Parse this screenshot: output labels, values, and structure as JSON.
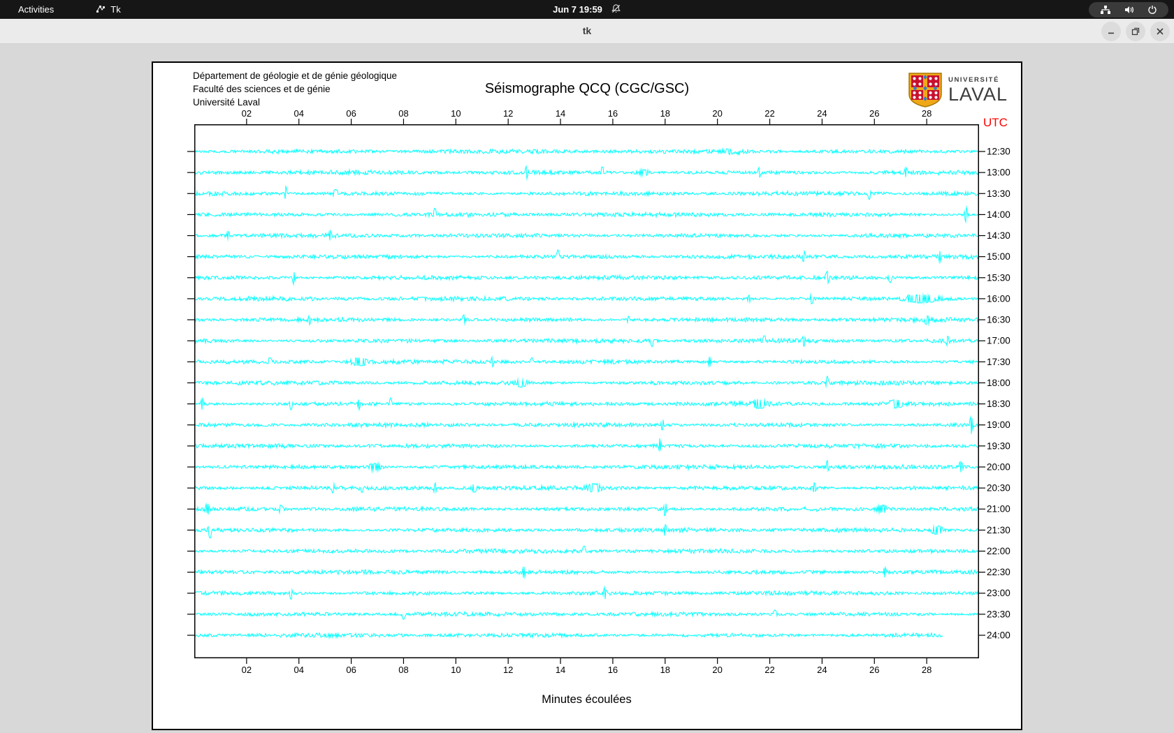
{
  "topbar": {
    "activities_label": "Activities",
    "app_name": "Tk",
    "clock": "Jun 7 19:59"
  },
  "window": {
    "title": "tk"
  },
  "canvas_header": {
    "line1": "Département de géologie et de génie géologique",
    "line2": "Faculté des sciences et de génie",
    "line3": "Université Laval"
  },
  "logo": {
    "line1": "UNIVERSITÉ",
    "line2": "LAVAL"
  },
  "colors": {
    "trace": "#00ffff",
    "utc_label": "#ff0000",
    "axis": "#000000"
  },
  "chart_data": {
    "type": "line",
    "title": "Séismographe QCQ (CGC/GSC)",
    "xlabel": "Minutes écoulées",
    "y_axis_label": "UTC",
    "x_range_minutes": [
      0,
      30
    ],
    "x_tick_labels": [
      "02",
      "04",
      "06",
      "08",
      "10",
      "12",
      "14",
      "16",
      "18",
      "20",
      "22",
      "24",
      "26",
      "28"
    ],
    "rows": [
      {
        "utc": "12:30",
        "end": 30,
        "spikes": [
          [
            20.5,
            2.5,
            12
          ]
        ]
      },
      {
        "utc": "13:00",
        "end": 30,
        "spikes": [
          [
            12.7,
            7,
            1.2
          ],
          [
            15.6,
            8,
            1.2
          ],
          [
            17.2,
            3,
            10
          ],
          [
            21.6,
            6,
            1.2
          ],
          [
            27.2,
            6,
            1.2
          ]
        ]
      },
      {
        "utc": "13:30",
        "end": 30,
        "spikes": [
          [
            3.5,
            9,
            1.2
          ],
          [
            5.4,
            4,
            3
          ],
          [
            25.8,
            7,
            1.2
          ]
        ]
      },
      {
        "utc": "14:00",
        "end": 30,
        "spikes": [
          [
            9.2,
            7,
            1.2
          ],
          [
            29.5,
            10,
            1.5
          ]
        ]
      },
      {
        "utc": "14:30",
        "end": 30,
        "spikes": [
          [
            1.3,
            4,
            2
          ],
          [
            5.2,
            4,
            2
          ]
        ]
      },
      {
        "utc": "15:00",
        "end": 30,
        "spikes": [
          [
            13.9,
            8,
            1.2
          ],
          [
            23.3,
            7,
            1.2
          ],
          [
            28.5,
            5,
            1.5
          ]
        ]
      },
      {
        "utc": "15:30",
        "end": 30,
        "spikes": [
          [
            3.8,
            8,
            1.2
          ],
          [
            24.2,
            7,
            1.5
          ],
          [
            26.6,
            6,
            1.5
          ]
        ]
      },
      {
        "utc": "16:00",
        "end": 30,
        "spikes": [
          [
            21.2,
            4,
            2
          ],
          [
            23.6,
            6,
            1.5
          ],
          [
            27.8,
            4,
            18
          ]
        ]
      },
      {
        "utc": "16:30",
        "end": 30,
        "spikes": [
          [
            4.4,
            5,
            1.2
          ],
          [
            10.3,
            6,
            1.2
          ],
          [
            16.6,
            4,
            1.5
          ],
          [
            28.0,
            4,
            3
          ]
        ]
      },
      {
        "utc": "17:00",
        "end": 30,
        "spikes": [
          [
            17.5,
            7,
            1.2
          ],
          [
            21.8,
            5,
            1.5
          ],
          [
            23.3,
            6,
            1.2
          ],
          [
            28.8,
            5,
            1.5
          ]
        ]
      },
      {
        "utc": "17:30",
        "end": 30,
        "spikes": [
          [
            2.9,
            6,
            1.5
          ],
          [
            6.3,
            4,
            8
          ],
          [
            11.4,
            5,
            1.5
          ],
          [
            12.9,
            6,
            1.2
          ],
          [
            19.7,
            6,
            1.5
          ]
        ]
      },
      {
        "utc": "18:00",
        "end": 30,
        "spikes": [
          [
            12.5,
            4,
            6
          ],
          [
            24.2,
            8,
            1.2
          ]
        ]
      },
      {
        "utc": "18:30",
        "end": 30,
        "spikes": [
          [
            0.3,
            7,
            1.2
          ],
          [
            3.7,
            8,
            1.2
          ],
          [
            6.3,
            6,
            1.2
          ],
          [
            7.5,
            7,
            1.2
          ],
          [
            21.6,
            4,
            8
          ],
          [
            26.8,
            3.5,
            10
          ]
        ]
      },
      {
        "utc": "19:00",
        "end": 30,
        "spikes": [
          [
            17.9,
            8,
            1.2
          ],
          [
            29.7,
            11,
            1.5
          ]
        ]
      },
      {
        "utc": "19:30",
        "end": 30,
        "spikes": [
          [
            17.8,
            9,
            1.2
          ]
        ]
      },
      {
        "utc": "20:00",
        "end": 30,
        "spikes": [
          [
            6.9,
            4,
            8
          ],
          [
            24.2,
            8,
            1.2
          ],
          [
            29.3,
            6,
            2
          ]
        ]
      },
      {
        "utc": "20:30",
        "end": 30,
        "spikes": [
          [
            5.3,
            5,
            1.5
          ],
          [
            6.4,
            4,
            1.5
          ],
          [
            9.2,
            6,
            1.5
          ],
          [
            10.7,
            4,
            3
          ],
          [
            15.3,
            4,
            8
          ],
          [
            23.7,
            6,
            1.5
          ]
        ]
      },
      {
        "utc": "21:00",
        "end": 30,
        "spikes": [
          [
            0.5,
            6,
            2
          ],
          [
            3.3,
            4,
            2
          ],
          [
            18.0,
            10,
            1.5
          ],
          [
            26.3,
            4,
            6
          ]
        ]
      },
      {
        "utc": "21:30",
        "end": 30,
        "spikes": [
          [
            0.6,
            10,
            1.5
          ],
          [
            18.0,
            7,
            1.2
          ],
          [
            28.4,
            5,
            6
          ]
        ]
      },
      {
        "utc": "22:00",
        "end": 30,
        "spikes": [
          [
            14.9,
            6,
            1.2
          ]
        ]
      },
      {
        "utc": "22:30",
        "end": 30,
        "spikes": [
          [
            12.6,
            6,
            1.5
          ],
          [
            26.4,
            6,
            1.5
          ]
        ]
      },
      {
        "utc": "23:00",
        "end": 30,
        "spikes": [
          [
            3.7,
            8,
            1.2
          ],
          [
            15.7,
            7,
            1.2
          ]
        ]
      },
      {
        "utc": "23:30",
        "end": 30,
        "spikes": [
          [
            8.0,
            6,
            1.5
          ],
          [
            22.2,
            5,
            1.5
          ]
        ]
      },
      {
        "utc": "24:00",
        "end": 28.6,
        "spikes": []
      }
    ]
  }
}
